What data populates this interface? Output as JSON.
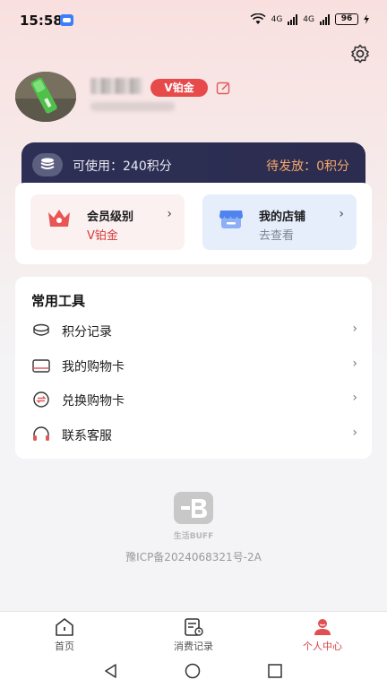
{
  "status_bar": {
    "time": "15:58",
    "network_1": "4G",
    "network_2": "4G",
    "battery": "96"
  },
  "profile": {
    "vip_badge": "V铂金"
  },
  "points": {
    "available": "可使用：240积分",
    "pending": "待发放：0积分"
  },
  "cards": {
    "member": {
      "title": "会员级别",
      "subtitle": "V铂金",
      "chevron": "›"
    },
    "store": {
      "title": "我的店铺",
      "subtitle": "去查看",
      "chevron": "›"
    }
  },
  "tools": {
    "title": "常用工具",
    "items": [
      {
        "label": "积分记录",
        "icon": "coins-icon"
      },
      {
        "label": "我的购物卡",
        "icon": "card-icon"
      },
      {
        "label": "兑换购物卡",
        "icon": "exchange-icon"
      },
      {
        "label": "联系客服",
        "icon": "headset-icon"
      }
    ],
    "chevron": "›"
  },
  "footer": {
    "brand": "生活BUFF",
    "icp": "豫ICP备2024068321号-2A"
  },
  "bottom_nav": {
    "items": [
      {
        "label": "首页",
        "icon": "home-icon"
      },
      {
        "label": "消费记录",
        "icon": "receipt-icon"
      },
      {
        "label": "个人中心",
        "icon": "user-icon",
        "active": true
      }
    ]
  },
  "colors": {
    "accent": "#e74a4a",
    "points_bar": "#2d2f55",
    "pending": "#f7a86a"
  }
}
